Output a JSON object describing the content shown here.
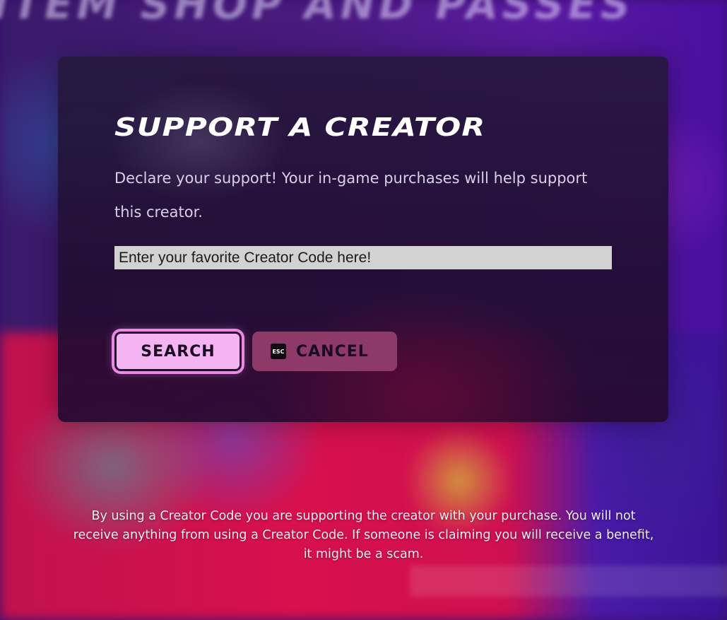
{
  "background": {
    "heading": "ITEM SHOP AND PASSES"
  },
  "dialog": {
    "title": "SUPPORT A CREATOR",
    "description": "Declare your support! Your in-game purchases will help support this creator.",
    "input": {
      "value": "",
      "placeholder": "Enter your favorite Creator Code here!"
    },
    "search_button": {
      "label": "SEARCH"
    },
    "cancel_button": {
      "label": "CANCEL",
      "key_hint": "ESC",
      "key_icon": "esc-key-icon"
    }
  },
  "disclaimer": "By using a Creator Code you are supporting the creator with your purchase. You will not receive anything from using a Creator Code. If someone is claiming you will receive a benefit, it might be a scam.",
  "colors": {
    "search_button_bg": "#f4b3f2",
    "search_button_glow": "#e98be4",
    "cancel_button_bg": "#8e3a68",
    "input_bg": "#d2d2d2"
  }
}
